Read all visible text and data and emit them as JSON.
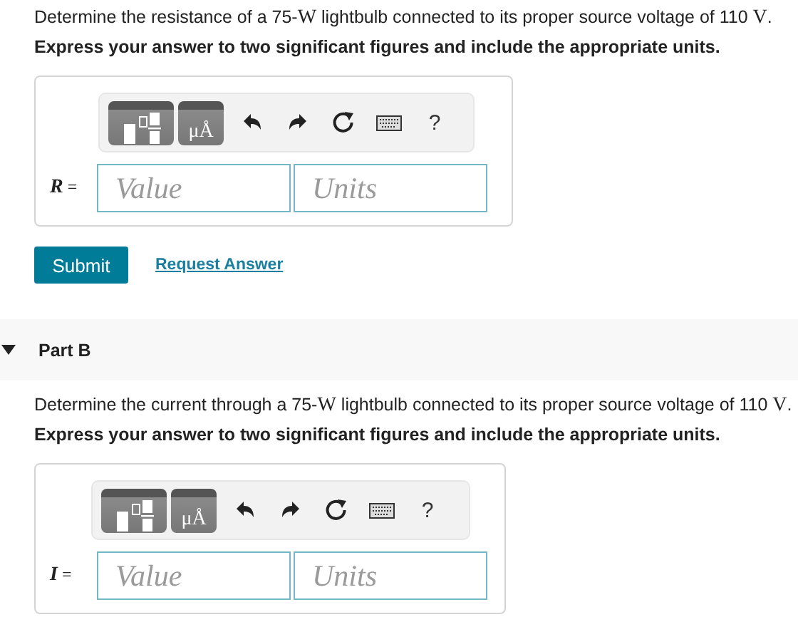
{
  "parts": [
    {
      "question": [
        {
          "kind": "plain",
          "text": "Determine the resistance of a 75-"
        },
        {
          "kind": "math",
          "text": "W"
        },
        {
          "kind": "plain",
          "text": " lightbulb connected to its proper source voltage of 110 "
        },
        {
          "kind": "math",
          "text": "V"
        },
        {
          "kind": "plain",
          "text": "."
        }
      ],
      "instruction": "Express your answer to two significant figures and include the appropriate units.",
      "toolbar": [
        {
          "kind": "template"
        },
        {
          "kind": "units",
          "label": "μÅ"
        },
        {
          "kind": "undo"
        },
        {
          "kind": "redo"
        },
        {
          "kind": "reset"
        },
        {
          "kind": "keyboard"
        },
        {
          "kind": "help",
          "label": "?"
        }
      ],
      "variable": "R",
      "equals": "=",
      "value": {
        "placeholder": "Value"
      },
      "units": {
        "placeholder": "Units"
      },
      "actions": {
        "submit": "Submit",
        "request": "Request Answer"
      }
    },
    {
      "header": {
        "title": "Part B",
        "expanded": true
      },
      "question": [
        {
          "kind": "plain",
          "text": "Determine the current through a 75-"
        },
        {
          "kind": "math",
          "text": "W"
        },
        {
          "kind": "plain",
          "text": " lightbulb connected to its proper source voltage of 110 "
        },
        {
          "kind": "math",
          "text": "V"
        },
        {
          "kind": "plain",
          "text": "."
        }
      ],
      "instruction": "Express your answer to two significant figures and include the appropriate units.",
      "toolbar": [
        {
          "kind": "template"
        },
        {
          "kind": "units",
          "label": "μÅ"
        },
        {
          "kind": "undo"
        },
        {
          "kind": "redo"
        },
        {
          "kind": "reset"
        },
        {
          "kind": "keyboard"
        },
        {
          "kind": "help",
          "label": "?"
        }
      ],
      "variable": "I",
      "equals": "=",
      "value": {
        "placeholder": "Value"
      },
      "units": {
        "placeholder": "Units"
      }
    }
  ]
}
